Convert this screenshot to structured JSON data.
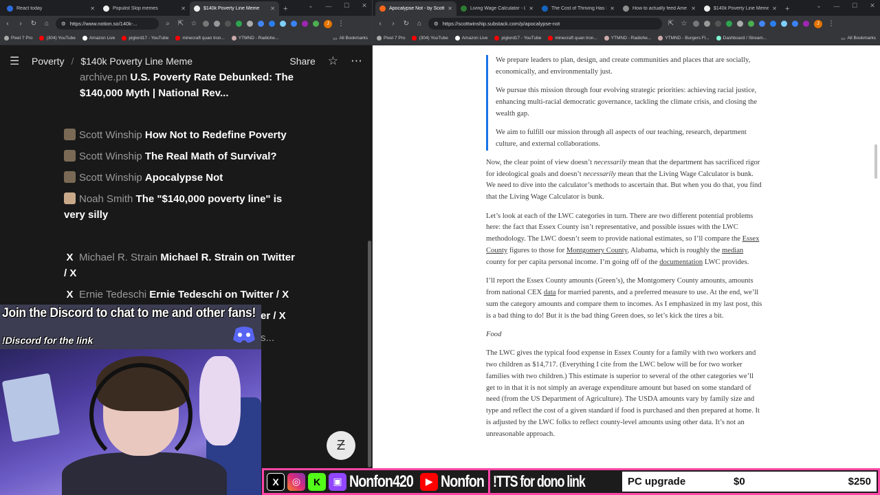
{
  "left_browser": {
    "tabs": [
      {
        "title": "React today",
        "fav_color": "#2d6cdf"
      },
      {
        "title": "Populist Slop memes",
        "fav_color": "#eeeeee"
      },
      {
        "title": "$140k Poverty Line Meme",
        "fav_color": "#eeeeee",
        "active": true
      }
    ],
    "url": "https://www.notion.so/140k-...",
    "bookmarks": [
      "Pixel 7 Pro",
      "(304) YouTube",
      "Amazon Live",
      "piglord17 - YouTube",
      "minecraft quan tron...",
      "YTMND - Radiohe..."
    ],
    "all_bookmarks": "All Bookmarks"
  },
  "notion": {
    "breadcrumb_parent": "Poverty",
    "page_title": "$140k Poverty Line Meme",
    "share": "Share",
    "items": [
      {
        "source": "archive.pn",
        "link": "U.S. Poverty Rate Debunked: The $140,000 Myth | National Rev...",
        "icon": "globe-icon"
      },
      {
        "source": "Scott Winship",
        "link": "How Not to Redefine Poverty",
        "icon": "substack-icon"
      },
      {
        "source": "Scott Winship",
        "link": "The Real Math of Survival?",
        "icon": "substack-icon"
      },
      {
        "source": "Scott Winship",
        "link": "Apocalypse Not",
        "icon": "substack-icon"
      },
      {
        "source": "Noah Smith",
        "link": "The \"$140,000 poverty line\" is very silly",
        "icon": "substack-icon"
      },
      {
        "source": "Michael R. Strain",
        "link": "Michael R. Strain on Twitter / X",
        "icon": "x-icon"
      },
      {
        "source": "Ernie Tedeschi",
        "link": "Ernie Tedeschi on Twitter / X",
        "icon": "x-icon"
      },
      {
        "source": "",
        "link": "er / X",
        "icon": "x-icon"
      },
      {
        "source": "",
        "link": "s...",
        "icon": ""
      }
    ]
  },
  "right_browser": {
    "tabs": [
      {
        "title": "Apocalypse Not - by Scott",
        "fav_color": "#ff6719",
        "active": true
      },
      {
        "title": "Living Wage Calculator - Li",
        "fav_color": "#2e7d32"
      },
      {
        "title": "The Cost of Thriving Has R",
        "fav_color": "#1565c0"
      },
      {
        "title": "How to actually feed Ame",
        "fav_color": "#8e8e8e"
      },
      {
        "title": "$140k Poverty Line Meme",
        "fav_color": "#eeeeee"
      }
    ],
    "url": "https://scottwinship.substack.com/p/apocalypse-not",
    "bookmarks": [
      "Pixel 7 Pro",
      "(304) YouTube",
      "Amazon Live",
      "piglord17 - YouTube",
      "minecraft quan tron...",
      "YTMND - Radiohe...",
      "YTMND - Burgers Fl...",
      "Dashboard / Stream..."
    ],
    "all_bookmarks": "All Bookmarks"
  },
  "article": {
    "quote": [
      "We prepare leaders to plan, design, and create communities and places that are socially, economically, and environmentally just.",
      "We pursue this mission through four evolving strategic priorities: achieving racial justice, enhancing multi-racial democratic governance, tackling the climate crisis, and closing the wealth gap.",
      "We aim to fulfill our mission through all aspects of our teaching, research, department culture, and external collaborations."
    ],
    "p1_a": "Now, the clear point of view doesn’t ",
    "p1_em1": "necessarily",
    "p1_b": " mean that the department has sacrificed rigor for ideological goals and doesn’t ",
    "p1_em2": "necessarily",
    "p1_c": " mean that the Living Wage Calculator is bunk. We need to dive into the calculator’s methods to ascertain that. But when you do that, you find that the Living Wage Calculator is bunk.",
    "p2_a": "Let’s look at each of the LWC categories in turn. There are two different potential problems here: the fact that Essex County isn’t representative, and possible issues with the LWC methodology. The LWC doesn’t seem to provide national estimates, so I’ll compare the ",
    "p2_link1": "Essex County",
    "p2_b": " figures to those for ",
    "p2_link2": "Montgomery County",
    "p2_c": ", Alabama, which is roughly the ",
    "p2_link3": "median",
    "p2_d": " county for per capita personal income. I’m going off of the ",
    "p2_link4": "documentation",
    "p2_e": " LWC provides.",
    "p3_a": "I’ll report the Essex County amounts (Green’s), the Montgomery County amounts, amounts from national CEX ",
    "p3_link": "data",
    "p3_b": " for married parents, and a preferred measure to use. At the end, we’ll sum the category amounts and compare them to incomes. As I emphasized in my last post, this is a bad thing to do! But it is the bad thing Green does, so let’s kick the tires a bit.",
    "heading": "Food",
    "p4": "The LWC gives the typical food expense in Essex County for a family with two workers and two children as $14,717. (Everything I cite from the LWC below will be for two worker families with two children.) This estimate is superior to several of the other categories we’ll get to in that it is not simply an average expenditure amount but based on some standard of need (from the US Department of Agriculture). The USDA amounts vary by family size and type and reflect the cost of a given standard if food is purchased and then prepared at home. It is adjusted by the LWC folks to reflect county-level amounts using other data. It’s not an unreasonable approach."
  },
  "overlay": {
    "discord_title": "Join the Discord to chat to me and other fans!",
    "discord_sub": "!Discord for the link",
    "handle1": "Nonfon420",
    "handle2": "Nonfon",
    "tts": "!TTS for dono link",
    "goal_label": "PC upgrade",
    "goal_current": "$0",
    "goal_target": "$250",
    "helper_glyph": "Ƶ"
  }
}
